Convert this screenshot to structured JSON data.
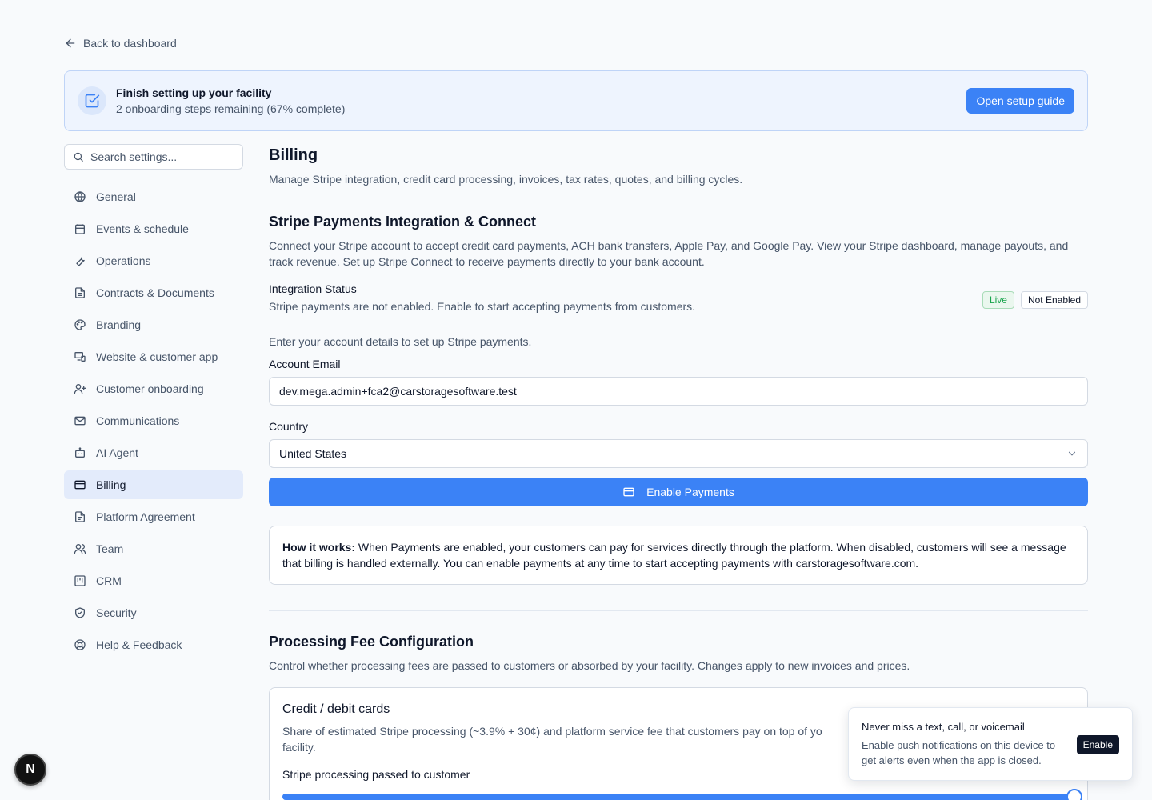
{
  "back_link": {
    "label": "Back to dashboard",
    "icon": "arrow-left-icon"
  },
  "banner": {
    "title": "Finish setting up your facility",
    "subtitle": "2 onboarding steps remaining (67% complete)",
    "button_label": "Open setup guide",
    "icon": "checkbox-icon"
  },
  "sidebar": {
    "search_placeholder": "Search settings...",
    "items": [
      {
        "label": "General",
        "icon": "globe-icon"
      },
      {
        "label": "Events & schedule",
        "icon": "calendar-icon"
      },
      {
        "label": "Operations",
        "icon": "wrench-icon"
      },
      {
        "label": "Contracts & Documents",
        "icon": "document-icon"
      },
      {
        "label": "Branding",
        "icon": "palette-icon"
      },
      {
        "label": "Website & customer app",
        "icon": "devices-icon"
      },
      {
        "label": "Customer onboarding",
        "icon": "user-plus-icon"
      },
      {
        "label": "Communications",
        "icon": "mail-icon"
      },
      {
        "label": "AI Agent",
        "icon": "bot-icon"
      },
      {
        "label": "Billing",
        "icon": "credit-card-icon",
        "active": true
      },
      {
        "label": "Platform Agreement",
        "icon": "file-text-icon"
      },
      {
        "label": "Team",
        "icon": "users-icon"
      },
      {
        "label": "CRM",
        "icon": "kanban-icon"
      },
      {
        "label": "Security",
        "icon": "shield-icon"
      },
      {
        "label": "Help & Feedback",
        "icon": "lifebuoy-icon"
      }
    ]
  },
  "main": {
    "title": "Billing",
    "description": "Manage Stripe integration, credit card processing, invoices, tax rates, quotes, and billing cycles.",
    "stripe": {
      "title": "Stripe Payments Integration & Connect",
      "description": "Connect your Stripe account to accept credit card payments, ACH bank transfers, Apple Pay, and Google Pay. View your Stripe dashboard, manage payouts, and track revenue. Set up Stripe Connect to receive payments directly to your bank account.",
      "status_label": "Integration Status",
      "status_description": "Stripe payments are not enabled. Enable to start accepting payments from customers.",
      "badge_live": "Live",
      "badge_status": "Not Enabled",
      "enter_note": "Enter your account details to set up Stripe payments.",
      "email_label": "Account Email",
      "email_value": "dev.mega.admin+fca2@carstoragesoftware.test",
      "country_label": "Country",
      "country_value": "United States",
      "enable_button": "Enable Payments",
      "how_it_works_bold": "How it works:",
      "how_it_works_text": " When Payments are enabled, your customers can pay for services directly through the platform. When disabled, customers will see a message that billing is handled externally. You can enable payments at any time to start accepting payments with carstoragesoftware.com."
    },
    "fees": {
      "title": "Processing Fee Configuration",
      "description": "Control whether processing fees are passed to customers or absorbed by your facility. Changes apply to new invoices and prices.",
      "card_title": "Credit / debit cards",
      "card_description": "Share of estimated Stripe processing (~3.9% + 30¢) and platform service fee that customers pay on top of yo",
      "card_description_tail": "facility.",
      "slider_label": "Stripe processing passed to customer",
      "slider_value": 1.0
    }
  },
  "toast": {
    "title": "Never miss a text, call, or voicemail",
    "description": "Enable push notifications on this device to get alerts even when the app is closed.",
    "button_label": "Enable"
  },
  "dev_badge": {
    "label": "N"
  },
  "colors": {
    "accent": "#3b82f6",
    "banner_bg": "#eef4fe",
    "active_nav": "#e3ebfb",
    "live_green": "#16a34a"
  }
}
